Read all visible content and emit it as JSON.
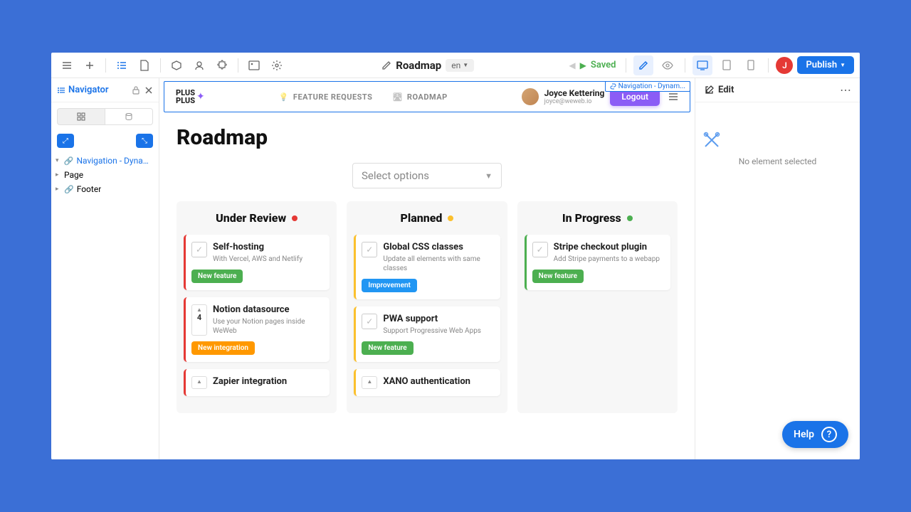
{
  "toolbar": {
    "page_title": "Roadmap",
    "lang": "en",
    "saved": "Saved",
    "avatar_initial": "J",
    "publish": "Publish"
  },
  "navigator": {
    "title": "Navigator",
    "items": [
      {
        "label": "Navigation - Dynam...",
        "selected": true,
        "linked": true
      },
      {
        "label": "Page",
        "selected": false,
        "linked": false
      },
      {
        "label": "Footer",
        "selected": false,
        "linked": true
      }
    ]
  },
  "site": {
    "logo_line1": "PLUS",
    "logo_line2": "PLUS",
    "nav": [
      {
        "label": "FEATURE REQUESTS"
      },
      {
        "label": "ROADMAP"
      }
    ],
    "user_name": "Joyce Kettering",
    "user_email": "joyce@weweb.io",
    "logout": "Logout",
    "selection_tag": "Navigation - Dynam..."
  },
  "roadmap": {
    "title": "Roadmap",
    "select_placeholder": "Select options",
    "columns": [
      {
        "title": "Under Review",
        "dot": "red",
        "cards": [
          {
            "vote_type": "check",
            "title": "Self-hosting",
            "desc": "With Vercel, AWS and Netlify",
            "tag": "New feature",
            "tag_color": "green"
          },
          {
            "vote_type": "count",
            "count": "4",
            "title": "Notion datasource",
            "desc": "Use your Notion pages inside WeWeb",
            "tag": "New integration",
            "tag_color": "orange"
          },
          {
            "vote_type": "count",
            "count": "",
            "title": "Zapier integration",
            "desc": "",
            "tag": "",
            "tag_color": ""
          }
        ]
      },
      {
        "title": "Planned",
        "dot": "yellow",
        "cards": [
          {
            "vote_type": "check",
            "title": "Global CSS classes",
            "desc": "Update all elements with same classes",
            "tag": "Improvement",
            "tag_color": "blue"
          },
          {
            "vote_type": "check",
            "title": "PWA support",
            "desc": "Support Progressive Web Apps",
            "tag": "New feature",
            "tag_color": "green"
          },
          {
            "vote_type": "count",
            "count": "",
            "title": "XANO authentication",
            "desc": "",
            "tag": "",
            "tag_color": ""
          }
        ]
      },
      {
        "title": "In Progress",
        "dot": "green",
        "cards": [
          {
            "vote_type": "check",
            "title": "Stripe checkout plugin",
            "desc": "Add Stripe payments to a webapp",
            "tag": "New feature",
            "tag_color": "green"
          }
        ]
      }
    ]
  },
  "edit_panel": {
    "title": "Edit",
    "empty_text": "No element selected"
  },
  "help": {
    "label": "Help"
  }
}
